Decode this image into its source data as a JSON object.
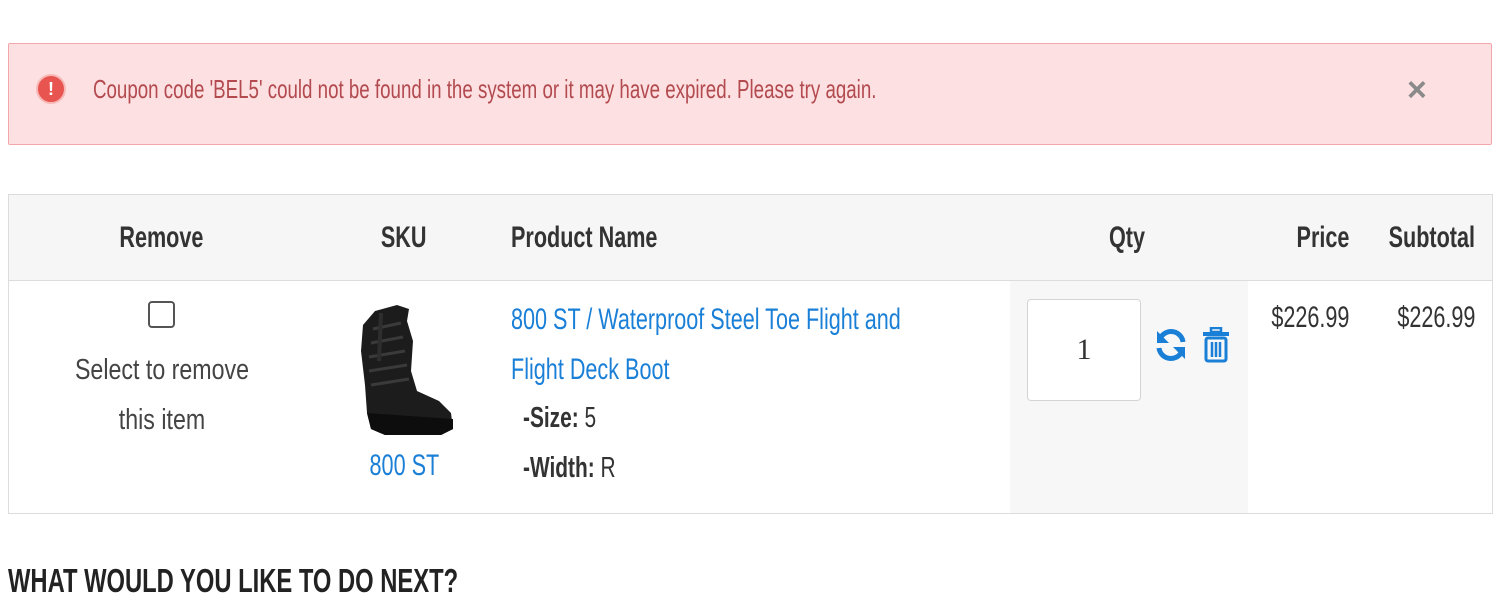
{
  "alert": {
    "message": "Coupon code 'BEL5' could not be found in the system or it may have expired. Please try again.",
    "icon": "alert-circle-icon",
    "close_symbol": "×",
    "color": "#b24a4f",
    "background": "#fde0e1"
  },
  "table": {
    "headers": {
      "remove": "Remove",
      "sku": "SKU",
      "product_name": "Product Name",
      "qty": "Qty",
      "price": "Price",
      "subtotal": "Subtotal"
    },
    "rows": [
      {
        "remove_label": "Select to remove this item",
        "remove_checked": false,
        "sku": "800 ST",
        "product_name_line1": "800 ST / Waterproof Steel Toe Flight and",
        "product_name_line2": "Flight Deck Boot",
        "options": [
          {
            "label": "-Size:",
            "value": "5"
          },
          {
            "label": "-Width:",
            "value": "R"
          }
        ],
        "qty": "1",
        "price": "$226.99",
        "subtotal": "$226.99"
      }
    ]
  },
  "next_heading": "WHAT WOULD YOU LIKE TO DO NEXT?",
  "colors": {
    "link": "#1a7fd6",
    "header_bg": "#f6f6f6"
  }
}
